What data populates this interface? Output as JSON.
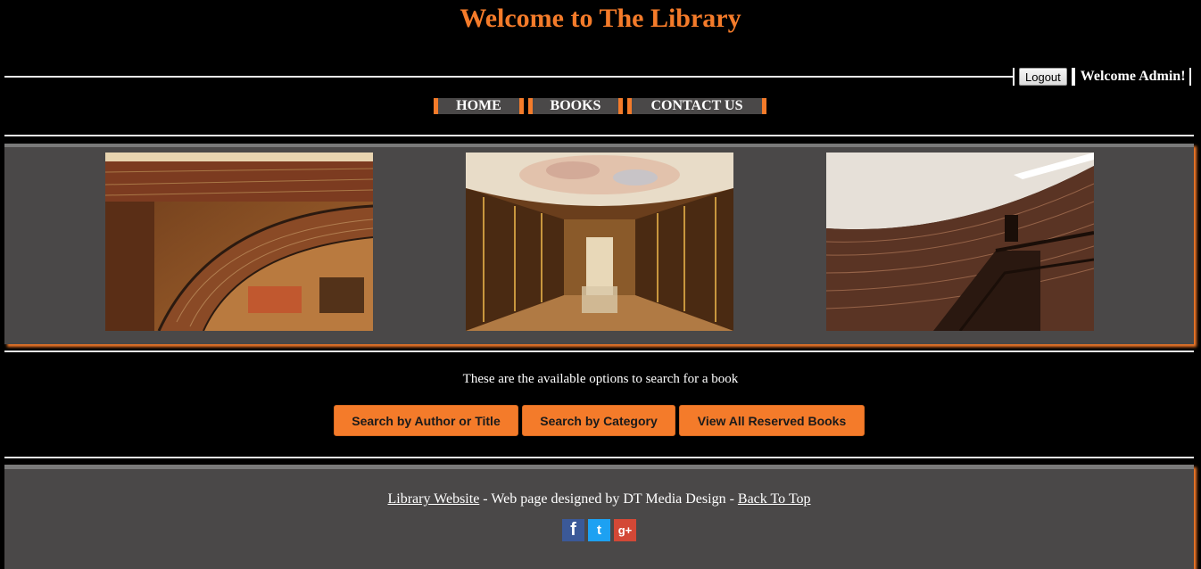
{
  "header": {
    "title": "Welcome to The Library",
    "logout_label": "Logout",
    "welcome_text": "Welcome Admin!"
  },
  "nav": {
    "items": [
      {
        "label": "HOME"
      },
      {
        "label": "BOOKS"
      },
      {
        "label": "CONTACT US"
      }
    ]
  },
  "gallery": {
    "images": [
      {
        "subject": "circular-library-interior-photo"
      },
      {
        "subject": "baroque-library-hall-photo"
      },
      {
        "subject": "rotunda-library-shelves-photo"
      }
    ]
  },
  "search": {
    "intro": "These are the available options to search for a book",
    "buttons": [
      {
        "label": "Search by Author or Title"
      },
      {
        "label": "Search by Category"
      },
      {
        "label": "View All Reserved Books"
      }
    ]
  },
  "footer": {
    "site_link": "Library Website",
    "separator_1": " - Web page designed by DT Media Design - ",
    "back_to_top": "Back To Top",
    "social": [
      {
        "icon": "facebook-icon",
        "glyph": "f"
      },
      {
        "icon": "twitter-icon",
        "glyph": "t"
      },
      {
        "icon": "google-plus-icon",
        "glyph": "g+"
      }
    ]
  },
  "colors": {
    "accent": "#f47b2a",
    "panel": "#4a4848",
    "background": "#000000"
  }
}
